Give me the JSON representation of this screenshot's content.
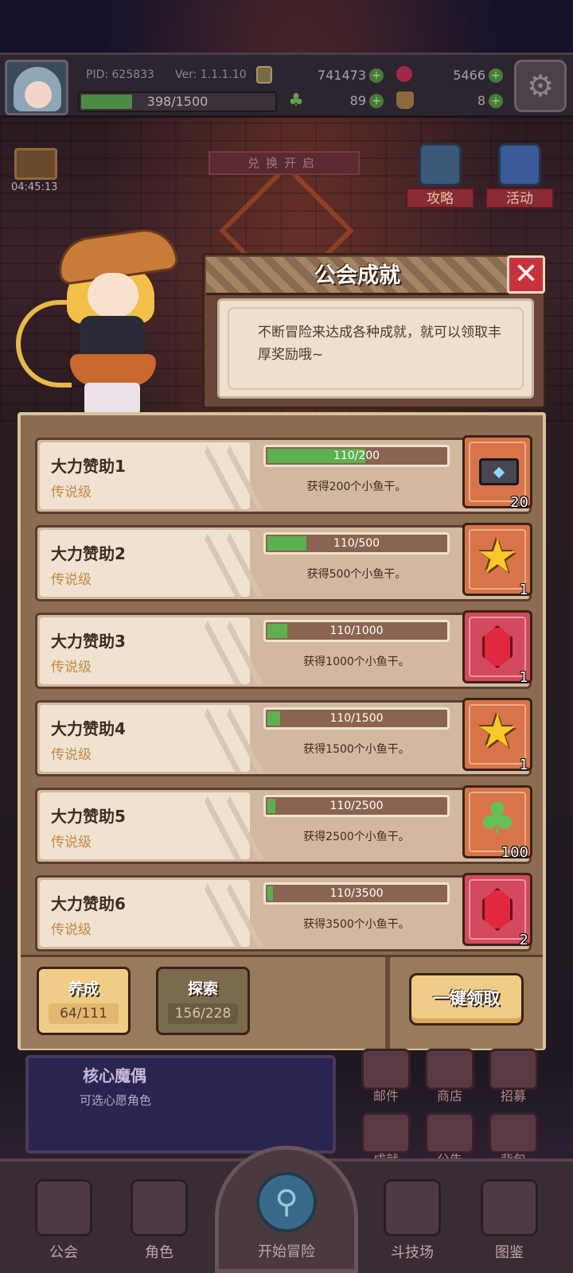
{
  "hud": {
    "pid": "PID: 625833",
    "version": "Ver: 1.1.1.10",
    "coins": "741473",
    "gems": "5466",
    "xp_text": "398/1500",
    "xp_fraction": 0.265,
    "clovers": "89",
    "bags": "8",
    "plus": "+"
  },
  "scene": {
    "timer": "04:45:13",
    "banner": "兑换开启",
    "guide_label": "攻略",
    "event_label": "活动"
  },
  "dialog": {
    "title": "公会成就",
    "close": "✕",
    "description": "不断冒险来达成各种成就，就可以领取丰厚奖励哦~"
  },
  "achievements": [
    {
      "name": "大力赞助1",
      "tier": "传说级",
      "progress": "110/200",
      "fraction": 0.55,
      "reward": "获得200个小鱼干。",
      "icon": "envelope-icon",
      "box": "orange",
      "qty": "20"
    },
    {
      "name": "大力赞助2",
      "tier": "传说级",
      "progress": "110/500",
      "fraction": 0.22,
      "reward": "获得500个小鱼干。",
      "icon": "star-icon",
      "box": "orange",
      "qty": "1"
    },
    {
      "name": "大力赞助3",
      "tier": "传说级",
      "progress": "110/1000",
      "fraction": 0.11,
      "reward": "获得1000个小鱼干。",
      "icon": "ruby-icon",
      "box": "red",
      "qty": "1"
    },
    {
      "name": "大力赞助4",
      "tier": "传说级",
      "progress": "110/1500",
      "fraction": 0.0733,
      "reward": "获得1500个小鱼干。",
      "icon": "star-icon",
      "box": "orange",
      "qty": "1"
    },
    {
      "name": "大力赞助5",
      "tier": "传说级",
      "progress": "110/2500",
      "fraction": 0.044,
      "reward": "获得2500个小鱼干。",
      "icon": "clover-icon",
      "box": "orange",
      "qty": "100"
    },
    {
      "name": "大力赞助6",
      "tier": "传说级",
      "progress": "110/3500",
      "fraction": 0.0314,
      "reward": "获得3500个小鱼干。",
      "icon": "ruby-icon",
      "box": "red",
      "qty": "2"
    }
  ],
  "tabs": {
    "nurture": {
      "label": "养成",
      "count": "64/111"
    },
    "explore": {
      "label": "探索",
      "count": "156/228"
    }
  },
  "claim_all": "一键领取",
  "lower": {
    "core_title": "核心魔偶",
    "core_sub": "可选心愿角色",
    "mail": "邮件",
    "shop": "商店",
    "recruit": "招募",
    "achievement": "成就",
    "notice": "公告",
    "backpack": "背包"
  },
  "nav": {
    "guild": "公会",
    "character": "角色",
    "adventure": "开始冒险",
    "arena": "斗技场",
    "codex": "图鉴"
  }
}
